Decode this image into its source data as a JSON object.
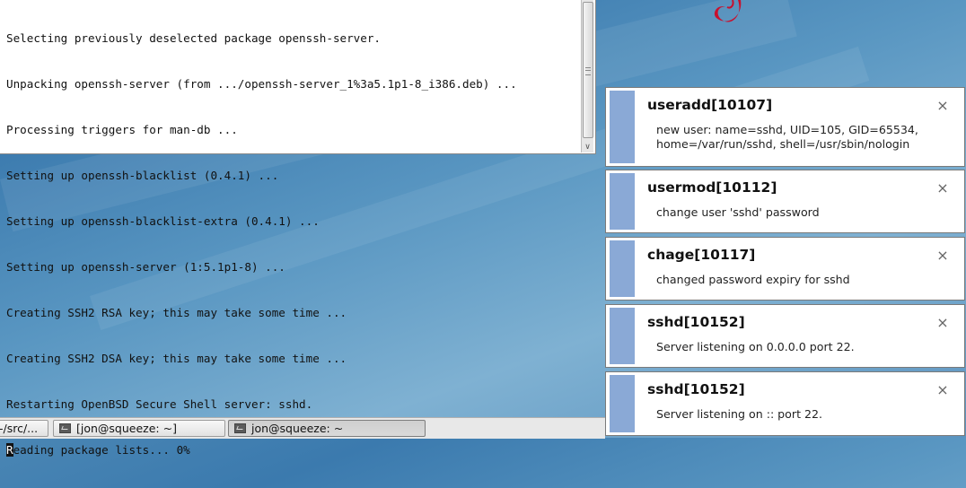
{
  "terminal": {
    "lines": [
      "Selecting previously deselected package openssh-server.",
      "Unpacking openssh-server (from .../openssh-server_1%3a5.1p1-8_i386.deb) ...",
      "Processing triggers for man-db ...",
      "Setting up openssh-blacklist (0.4.1) ...",
      "Setting up openssh-blacklist-extra (0.4.1) ...",
      "Setting up openssh-server (1:5.1p1-8) ...",
      "Creating SSH2 RSA key; this may take some time ...",
      "Creating SSH2 DSA key; this may take some time ...",
      "Restarting OpenBSD Secure Shell server: sshd."
    ],
    "last_line_cursor_char": "R",
    "last_line_rest": "eading package lists... 0%"
  },
  "notifications": [
    {
      "title": "useradd[10107]",
      "body": "new user: name=sshd, UID=105, GID=65534, home=/var/run/sshd, shell=/usr/sbin/nologin",
      "close_icon": "×"
    },
    {
      "title": "usermod[10112]",
      "body": "change user 'sshd' password",
      "close_icon": "×"
    },
    {
      "title": "chage[10117]",
      "body": "changed password expiry for sshd",
      "close_icon": "×"
    },
    {
      "title": "sshd[10152]",
      "body": "Server listening on 0.0.0.0 port 22.",
      "close_icon": "×"
    },
    {
      "title": "sshd[10152]",
      "body": "Server listening on :: port 22.",
      "close_icon": "×"
    }
  ],
  "taskbar": {
    "items": [
      {
        "label": "-/src/...",
        "active": false
      },
      {
        "label": "[jon@squeeze: ~]",
        "active": false
      },
      {
        "label": "jon@squeeze: ~",
        "active": true
      }
    ]
  },
  "colors": {
    "notification_stripe": "#8aa9d6",
    "debian_swirl": "#c8102e",
    "desktop_blue": "#4a86b4"
  }
}
